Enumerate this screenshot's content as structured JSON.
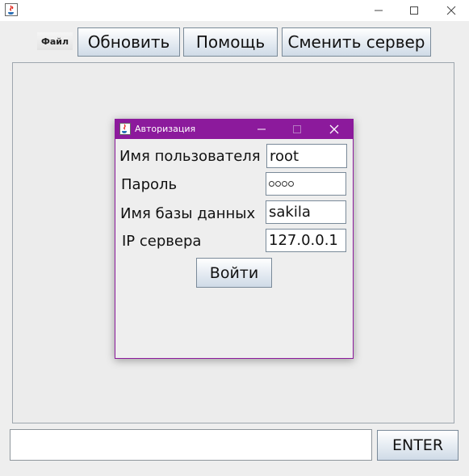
{
  "window": {
    "icon": "java-cup-icon",
    "controls": [
      "minimize-icon",
      "maximize-icon",
      "close-icon"
    ]
  },
  "menu": {
    "file_label": "Файл"
  },
  "toolbar": {
    "refresh_label": "Обновить",
    "help_label": "Помощь",
    "change_server_label": "Сменить сервер"
  },
  "command": {
    "input_value": "",
    "enter_label": "ENTER"
  },
  "login_dialog": {
    "title": "Авторизация",
    "username_label": "Имя пользователя",
    "username_value": "root",
    "password_label": "Пароль",
    "password_masked_length": 4,
    "database_label": "Имя базы данных",
    "database_value": "sakila",
    "server_ip_label": "IP сервера",
    "server_ip_value": "127.0.0.1",
    "login_label": "Войти"
  },
  "colors": {
    "dialog_titlebar": "#8c1a9c",
    "button_gradient_bottom": "#cfdbe7"
  }
}
